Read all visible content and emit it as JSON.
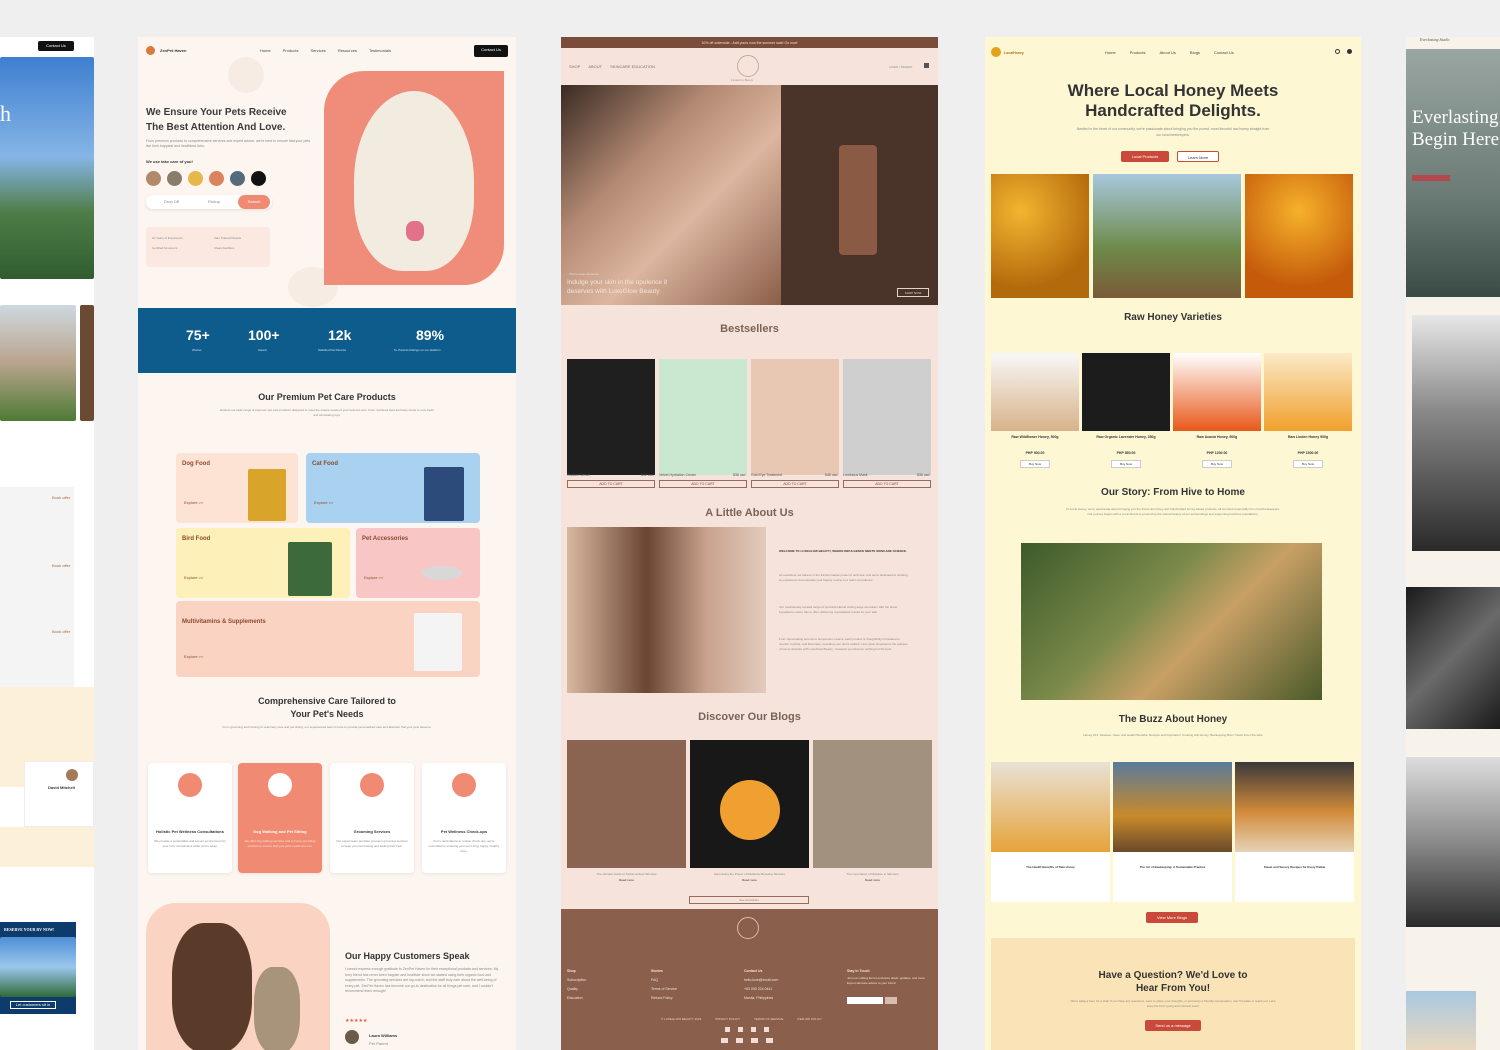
{
  "col1": {
    "contact_btn": "Contact Us",
    "book_label": "Book offer",
    "reviewer": "David Mitchell",
    "reserve_label": "RESERVE YOUR RV NOW!",
    "reserve_btn": "Let customers sit in"
  },
  "pet": {
    "logo": "ZenPet Haven",
    "nav": [
      "Home",
      "Products",
      "Services",
      "Resources",
      "Testimonials"
    ],
    "contact_btn": "Contact Us",
    "hero_title_1": "We Ensure Your Pets Receive",
    "hero_title_2": "The Best Attention And Love.",
    "hero_desc": "From premium products to comprehensive services and expert advice, we're here to ensure that your pets live their happiest and healthiest lives.",
    "care_label": "We use take care of you!",
    "drop_off": "Drop Off",
    "pickup": "Pickup",
    "search_btn": "Search",
    "features": [
      "10 Years of Experience",
      "Vets Trained Models",
      "Certified Groomers",
      "Clean Facilities"
    ],
    "stats": [
      {
        "value": "75+",
        "label": "Worker"
      },
      {
        "value": "100+",
        "label": "Award"
      },
      {
        "value": "12k",
        "label": "Satisfied Pet Parents"
      },
      {
        "value": "89%",
        "label": "5+ Parents Ratings on our platform"
      }
    ],
    "products_title": "Our Premium Pet Care Products",
    "products_desc": "Explore our wide range of premium pet care products designed to meet the unique needs of your beloved pets. From nutritious food and tasty treats to cozy beds and stimulating toys.",
    "categories": [
      "Dog Food",
      "Cat Food",
      "Bird Food",
      "Pet Accessories",
      "Multivitamins & Supplements"
    ],
    "explore": "Explore >>",
    "care_title_1": "Comprehensive Care Tailored to",
    "care_title_2": "Your Pet's Needs",
    "care_desc": "From grooming and training to veterinary care and pet sitting, our experienced team is here to provide personalized care and attention that your pets deserve.",
    "services": [
      {
        "title": "Holistic Pet Wellness Consultations",
        "desc": "We provide a comfortable and secure environment for your furry companions while you're away."
      },
      {
        "title": "Dog Walking and Pet Sitting",
        "desc": "We offer dog walking services and in-home pet sitting services to ensure that your pet's needs are met."
      },
      {
        "title": "Grooming Services",
        "desc": "Our expert team provides premium grooming services to keep your pet looking and feeling their best."
      },
      {
        "title": "Pet Wellness Check-ups",
        "desc": "From vaccinations to routine check-ups, we're committed to ensuring your pet's long, happy, healthy lives."
      }
    ],
    "testimonial_title": "Our Happy Customers Speak",
    "testimonial_text": "I cannot express enough gratitude to ZenPet Haven for their exceptional products and services. My furry friend has never been happier and healthier since we started using their organic food and supplements. The grooming services are top-notch, and the staff truly care about the well-being of every pet. ZenPet Haven has become our go-to destination for all things pet care, and I couldn't recommend them enough!",
    "reviewer": "Laura Williams",
    "reviewer_role": "Pet Parent"
  },
  "beauty": {
    "announcement": "10% off orderwide - Add yours now the summer sale! Go now!",
    "nav": [
      "SHOP",
      "ABOUT",
      "SKINCARE EDUCATION"
    ],
    "logo": "LuxeGlow Beauty",
    "login": "LOGIN / SIGNUP",
    "hero_small": "Whole-Asian-Essence",
    "hero_text_1": "Indulge your skin in the opulence it",
    "hero_text_2": "deserves with LuxeGlow Beauty",
    "shop_now": "SHOP NOW",
    "bestsellers_title": "Bestsellers",
    "products": [
      {
        "name": "Radiant Serum",
        "price": "$42 usd"
      },
      {
        "name": "Velvet Hydration Cream",
        "price": "$38 usd"
      },
      {
        "name": "Gold Eye Treatment",
        "price": "$48 usd"
      },
      {
        "name": "Luminous Mask",
        "price": "$36 usd"
      }
    ],
    "add_to_cart": "ADD TO CART",
    "about_title": "A Little About Us",
    "about_head": "WELCOME TO LUXEGLOW BEAUTY, WHERE INDULGENCE MEETS SKINCARE SCIENCE.",
    "about_p1": "At LuxeGlow, we believe in the transformative power of self-care, and we're dedicated to curating an experience that elevates your beauty routine to a realm of opulence.",
    "about_p2": "Our meticulously curated range of products blends cutting-edge innovation with the finest ingredients nature has to offer, delivering unparalleled results for your skin.",
    "about_p3": "From rejuvenating serums to sumptuous creams, each product is thoughtfully formulated to nourish, hydrate, and illuminate, revealing your skin's radiant, inner glow. Experience the epitome of luxury skincare with LuxeGlow Beauty - because you deserve nothing but the best.",
    "blogs_title": "Discover Our Blogs",
    "blogs": [
      "The ultimate Guide to Tackle Hollow Skincare",
      "Harnessing the Power of Radiance-Boosting Skincare",
      "The Importance of Moisture in Skincare"
    ],
    "read_more": "Read more",
    "see_all": "See all articles",
    "footer": {
      "shop": [
        "Shop",
        "Subscription",
        "Quality",
        "Education"
      ],
      "stories": [
        "Stories",
        "FAQ",
        "Terms of Service",
        "Refund Policy"
      ],
      "contact": [
        "Contact Us",
        "hello.luxe@email.com",
        "+63 000 224 0441",
        "Manila, Philippines"
      ],
      "touch_title": "Stay in Touch",
      "touch_desc": "Join our mailing list for exclusive deals, updates, and more. Expert skincare advice to your inbox!",
      "bottom": [
        "© LUXEGLOW BEAUTY 2024",
        "PRIVACY POLICY",
        "TERMS OF SERVICE",
        "REFUND POLICY"
      ]
    }
  },
  "honey": {
    "logo": "LocalHoney",
    "nav": [
      "Home",
      "Products",
      "About Us",
      "Blogs",
      "Contact Us"
    ],
    "hero_title_1": "Where Local Honey Meets",
    "hero_title_2": "Handcrafted Delights.",
    "hero_desc": "Nestled in the heart of our community, we're passionate about bringing you the purest, most flavorful raw honey straight from our local beekeepers.",
    "btn_products": "Local Products",
    "btn_learn": "Learn More",
    "varieties_title": "Raw Honey Varieties",
    "varieties": [
      {
        "name": "Raw Wildflower Honey, 500g",
        "price": "PHP 900.00"
      },
      {
        "name": "Raw Organic Lavender Honey, 350g",
        "price": "PHP 850.00"
      },
      {
        "name": "Raw Acacia Honey, 900g",
        "price": "PHP 1200.00"
      },
      {
        "name": "Raw Linden Honey 900g",
        "price": "PHP 1500.00"
      }
    ],
    "buy_now": "Buy Now",
    "story_title": "Our Story: From Hive to Home",
    "story_desc": "At Local Honey, we're passionate about bringing you the finest raw honey and handcrafted honey-based products, all sourced responsibly from local beekeepers. Our journey began with a commitment to preserving the natural beauty of our surroundings and supporting local bee populations.",
    "buzz_title": "The Buzz About Honey",
    "buzz_desc": "Honey 101: Varieties, Uses, and Health Benefits; Recipes and Inspiration: Cooking with Honey; Beekeeping Buzz: News From the Hive",
    "blogs": [
      "The Health Benefits of Raw Honey",
      "The Art of Beekeeping: A Sustainable Practice",
      "Sweet and Savory Recipes for Every Palate"
    ],
    "view_blogs": "View More Blogs",
    "question_title_1": "Have a Question? We'd Love to",
    "question_title_2": "Hear From You!",
    "question_desc": "We're always here for a chat! If you have any questions, want to share your thoughts, or just fancy a friendly conversation, don't hesitate to reach out. Let's keep the buzz going and connect soon!",
    "send_btn": "Send us a message"
  },
  "col5": {
    "brand": "Everlasting Studio",
    "hero_1": "Everlasting",
    "hero_2": "Begin Here"
  }
}
